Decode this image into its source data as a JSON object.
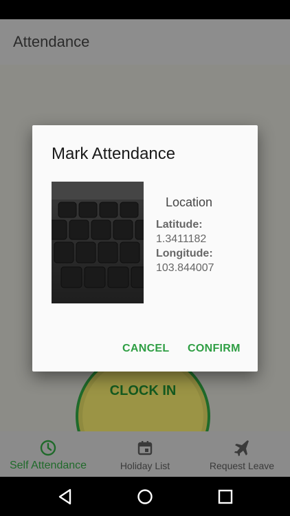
{
  "app_bar": {
    "title": "Attendance"
  },
  "clock": {
    "label": "CLOCK IN"
  },
  "dialog": {
    "title": "Mark Attendance",
    "location_heading": "Location",
    "latitude_label": "Latitude:",
    "latitude_value": "1.3411182",
    "longitude_label": "Longitude:",
    "longitude_value": "103.844007",
    "cancel_label": "CANCEL",
    "confirm_label": "CONFIRM",
    "photo_keys": [
      "8",
      "9",
      "I",
      "O",
      "P",
      "K",
      "L",
      ";",
      "(",
      ")"
    ]
  },
  "bottom_nav": [
    {
      "label": "Self Attendance",
      "icon": "clock-icon",
      "active": true
    },
    {
      "label": "Holiday List",
      "icon": "calendar-icon",
      "active": false
    },
    {
      "label": "Request Leave",
      "icon": "airplane-icon",
      "active": false
    }
  ],
  "system_nav": {
    "back": "back-icon",
    "home": "home-icon",
    "recents": "recents-icon"
  },
  "colors": {
    "accent": "#2e9e43",
    "active_nav": "#1f6a2a",
    "scrim": "#8c8c87"
  }
}
